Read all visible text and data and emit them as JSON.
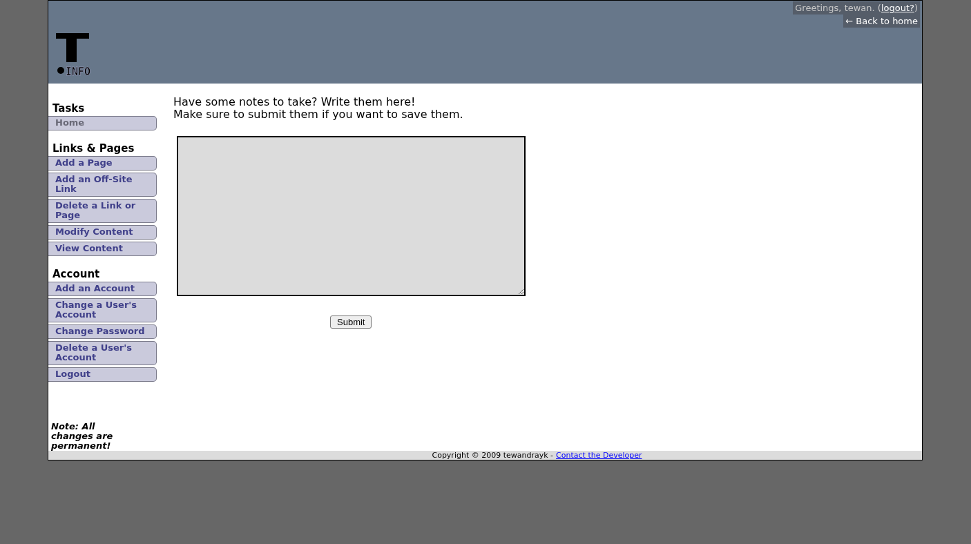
{
  "header": {
    "logo_text": "INFO",
    "greeting": {
      "before": "Greetings, tewan. (",
      "link": "logout?",
      "after": ")"
    },
    "back_link": "← Back to home"
  },
  "sidebar": {
    "sections": [
      {
        "title": "Tasks",
        "items": [
          {
            "label": "Home",
            "selected": true
          }
        ]
      },
      {
        "title": "Links & Pages",
        "items": [
          {
            "label": "Add a Page",
            "selected": false
          },
          {
            "label": "Add an Off-Site Link",
            "selected": false
          },
          {
            "label": "Delete a Link or Page",
            "selected": false
          },
          {
            "label": "Modify Content",
            "selected": false
          },
          {
            "label": "View Content",
            "selected": false
          }
        ]
      },
      {
        "title": "Account",
        "items": [
          {
            "label": "Add an Account",
            "selected": false
          },
          {
            "label": "Change a User's Account",
            "selected": false
          },
          {
            "label": "Change Password",
            "selected": false
          },
          {
            "label": "Delete a User's Account",
            "selected": false
          },
          {
            "label": "Logout",
            "selected": false
          }
        ]
      }
    ],
    "note": "Note: All changes are permanent!"
  },
  "content": {
    "intro": [
      "Have some notes to take? Write them here!",
      "Make sure to submit them if you want to save them."
    ],
    "submit": "Submit"
  },
  "footer": {
    "copyright": "Copyright © 2009 tewandrayk -",
    "link": "Contact the Developer"
  }
}
